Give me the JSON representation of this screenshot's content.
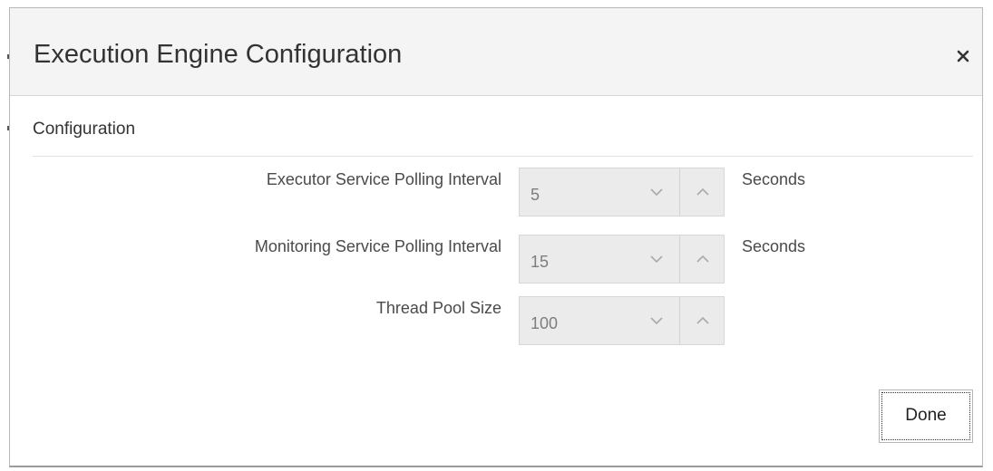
{
  "dialog": {
    "title": "Execution Engine Configuration",
    "close_icon": "close-icon"
  },
  "section": {
    "title": "Configuration"
  },
  "fields": [
    {
      "label": "Executor Service Polling Interval",
      "value": "5",
      "unit": "Seconds"
    },
    {
      "label": "Monitoring Service Polling Interval",
      "value": "15",
      "unit": "Seconds"
    },
    {
      "label": "Thread Pool Size",
      "value": "100",
      "unit": ""
    }
  ],
  "spinner_icons": {
    "decrement": "chevron-down-icon",
    "increment": "chevron-up-icon"
  },
  "footer": {
    "done_label": "Done"
  },
  "colors": {
    "header_bg": "#f4f4f4",
    "disabled_field_bg": "#ebebeb",
    "text": "#333333"
  }
}
